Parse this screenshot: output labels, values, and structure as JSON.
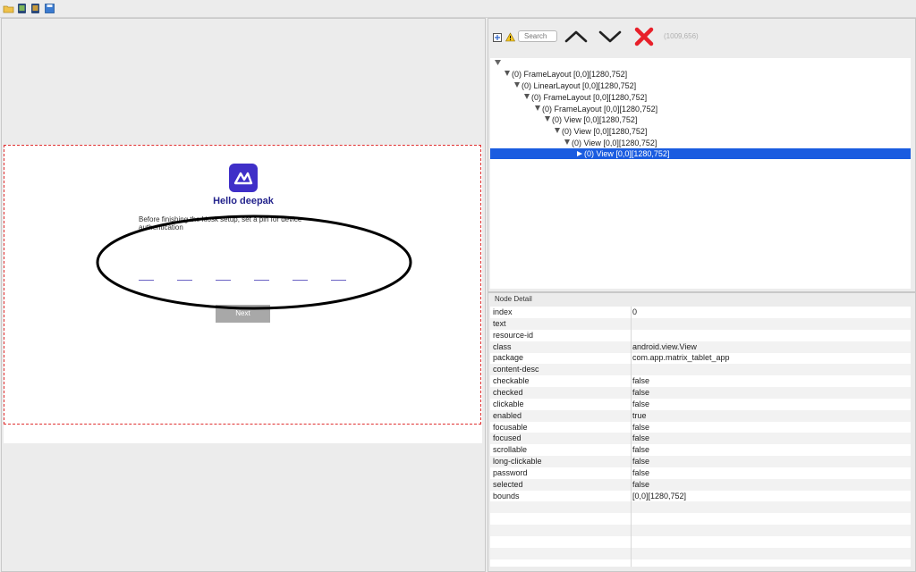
{
  "toolbar": {
    "icons": [
      "open-folder-icon",
      "device-screenshot-icon",
      "device-screenshot-compressed-icon",
      "save-icon"
    ]
  },
  "device": {
    "greeting": "Hello deepak",
    "instruction": "Before finishing the kiosk setup, set a pin for device authentication",
    "next_label": "Next",
    "pin_slots": 6,
    "colors": {
      "logo": "#3f2fc8",
      "greeting": "#23238c",
      "pin_line": "#6b63c4",
      "next_bg": "#a8a8a8"
    }
  },
  "inspector": {
    "search_placeholder": "Search",
    "coordinates": "(1009,656)",
    "icons": [
      "expand-all-icon",
      "warning-icon",
      "arrow-up-icon",
      "arrow-down-icon",
      "close-icon"
    ]
  },
  "tree": [
    "(0) FrameLayout [0,0][1280,752]",
    "(0) LinearLayout [0,0][1280,752]",
    "(0) FrameLayout [0,0][1280,752]",
    "(0) FrameLayout [0,0][1280,752]",
    "(0) View [0,0][1280,752]",
    "(0) View [0,0][1280,752]",
    "(0) View [0,0][1280,752]",
    "(0) View [0,0][1280,752]"
  ],
  "detail": {
    "title": "Node Detail",
    "rows": [
      {
        "key": "index",
        "value": "0"
      },
      {
        "key": "text",
        "value": ""
      },
      {
        "key": "resource-id",
        "value": ""
      },
      {
        "key": "class",
        "value": "android.view.View"
      },
      {
        "key": "package",
        "value": "com.app.matrix_tablet_app"
      },
      {
        "key": "content-desc",
        "value": ""
      },
      {
        "key": "checkable",
        "value": "false"
      },
      {
        "key": "checked",
        "value": "false"
      },
      {
        "key": "clickable",
        "value": "false"
      },
      {
        "key": "enabled",
        "value": "true"
      },
      {
        "key": "focusable",
        "value": "false"
      },
      {
        "key": "focused",
        "value": "false"
      },
      {
        "key": "scrollable",
        "value": "false"
      },
      {
        "key": "long-clickable",
        "value": "false"
      },
      {
        "key": "password",
        "value": "false"
      },
      {
        "key": "selected",
        "value": "false"
      },
      {
        "key": "bounds",
        "value": "[0,0][1280,752]"
      },
      {
        "key": "",
        "value": ""
      },
      {
        "key": "",
        "value": ""
      },
      {
        "key": "",
        "value": ""
      },
      {
        "key": "",
        "value": ""
      },
      {
        "key": "",
        "value": ""
      }
    ]
  }
}
